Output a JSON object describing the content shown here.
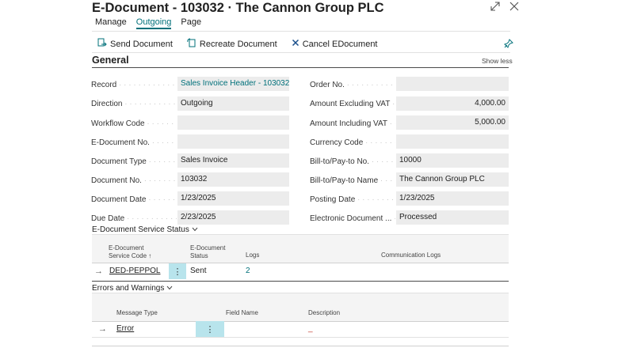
{
  "window": {
    "title": "E-Document - 103032 · The Cannon Group PLC"
  },
  "menu": {
    "items": [
      "Manage",
      "Outgoing",
      "Page"
    ],
    "active": "Outgoing"
  },
  "actions": {
    "send": "Send Document",
    "recreate": "Recreate Document",
    "cancel": "Cancel EDocument"
  },
  "general": {
    "title": "General",
    "show_less": "Show less",
    "left": [
      {
        "label": "Record",
        "value": "Sales Invoice Header - 103032",
        "link": true
      },
      {
        "label": "Direction",
        "value": "Outgoing"
      },
      {
        "label": "Workflow Code",
        "value": ""
      },
      {
        "label": "E-Document No.",
        "value": ""
      },
      {
        "label": "Document Type",
        "value": "Sales Invoice"
      },
      {
        "label": "Document No.",
        "value": "103032"
      },
      {
        "label": "Document Date",
        "value": "1/23/2025"
      },
      {
        "label": "Due Date",
        "value": "2/23/2025"
      }
    ],
    "right": [
      {
        "label": "Order No.",
        "value": ""
      },
      {
        "label": "Amount Excluding VAT",
        "value": "4,000.00",
        "num": true
      },
      {
        "label": "Amount Including VAT",
        "value": "5,000.00",
        "num": true
      },
      {
        "label": "Currency Code",
        "value": ""
      },
      {
        "label": "Bill-to/Pay-to No.",
        "value": "10000"
      },
      {
        "label": "Bill-to/Pay-to Name",
        "value": "The Cannon Group PLC"
      },
      {
        "label": "Posting Date",
        "value": "1/23/2025"
      },
      {
        "label": "Electronic Document ...",
        "value": "Processed"
      }
    ]
  },
  "service_status": {
    "title": "E-Document Service Status",
    "headers": {
      "service_code_1": "E-Document",
      "service_code_2": "Service Code ↑",
      "status_1": "E-Document",
      "status_2": "Status",
      "logs": "Logs",
      "comm_logs": "Communication Logs"
    },
    "row": {
      "service_code": "DED-PEPPOL",
      "status": "Sent",
      "logs": "2",
      "comm_logs": ""
    }
  },
  "errors": {
    "title": "Errors and Warnings",
    "headers": {
      "message_type": "Message Type",
      "field_name": "Field Name",
      "description": "Description"
    },
    "row": {
      "message_type": "Error",
      "field_name": "",
      "description": "_"
    }
  },
  "colors": {
    "accent": "#00707a",
    "field_bg": "#ececec",
    "kebab_bg": "#b8e4ec"
  }
}
